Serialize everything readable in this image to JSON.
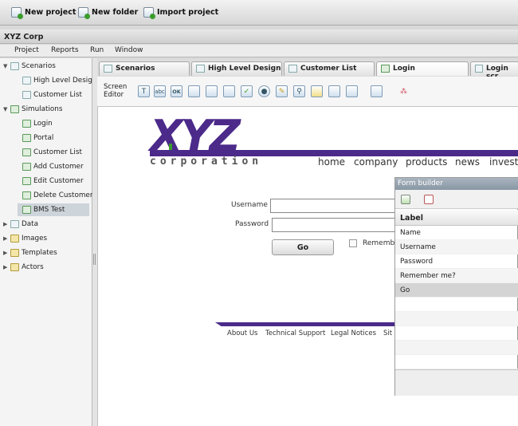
{
  "toolbar": {
    "new_project": "New project",
    "new_folder": "New folder",
    "import_project": "Import project"
  },
  "window": {
    "title": "XYZ Corp"
  },
  "menu": [
    "Project",
    "Reports",
    "Run",
    "Window"
  ],
  "sidebar": {
    "items": [
      {
        "label": "Scenarios"
      },
      {
        "label": "High Level Design"
      },
      {
        "label": "Customer List"
      },
      {
        "label": "Simulations"
      },
      {
        "label": "Login"
      },
      {
        "label": "Portal"
      },
      {
        "label": "Customer List"
      },
      {
        "label": "Add Customer"
      },
      {
        "label": "Edit Customer"
      },
      {
        "label": "Delete Customer"
      },
      {
        "label": "BMS Test"
      },
      {
        "label": "Data"
      },
      {
        "label": "Images"
      },
      {
        "label": "Templates"
      },
      {
        "label": "Actors"
      }
    ]
  },
  "tabs": [
    "Scenarios",
    "High Level Design",
    "Customer List",
    "Login",
    "Login scr"
  ],
  "editor": {
    "label_line1": "Screen",
    "label_line2": "Editor",
    "tools": [
      "text-tool-icon",
      "textfield-tool-icon",
      "button-tool-icon",
      "textarea-tool-icon",
      "list-tool-icon",
      "table-tool-icon",
      "checkbox-tool-icon",
      "radio-tool-icon",
      "link-tool-icon",
      "search-tool-icon",
      "image-tool-icon",
      "grid-tool-icon",
      "panel-tool-icon",
      "form-tool-icon",
      "component-tool-icon"
    ],
    "tool_glyphs": {
      "text": "T",
      "textfield": "abc",
      "button": "OK"
    }
  },
  "mock": {
    "logo_text": "XYZ",
    "logo_sub": "corporation",
    "nav": [
      "home",
      "company",
      "products",
      "news",
      "investo"
    ],
    "username_label": "Username",
    "password_label": "Password",
    "go_label": "Go",
    "remember_label": "Rememb",
    "footer": [
      "About Us",
      "Technical Support",
      "Legal Notices",
      "Sit"
    ]
  },
  "form_builder": {
    "title": "Form builder",
    "column_header": "Label",
    "rows": [
      "Name",
      "Username",
      "Password",
      "Remember me?",
      "Go"
    ]
  },
  "colors": {
    "brand": "#4b2a8a",
    "accent_green": "#3a9c2a"
  }
}
